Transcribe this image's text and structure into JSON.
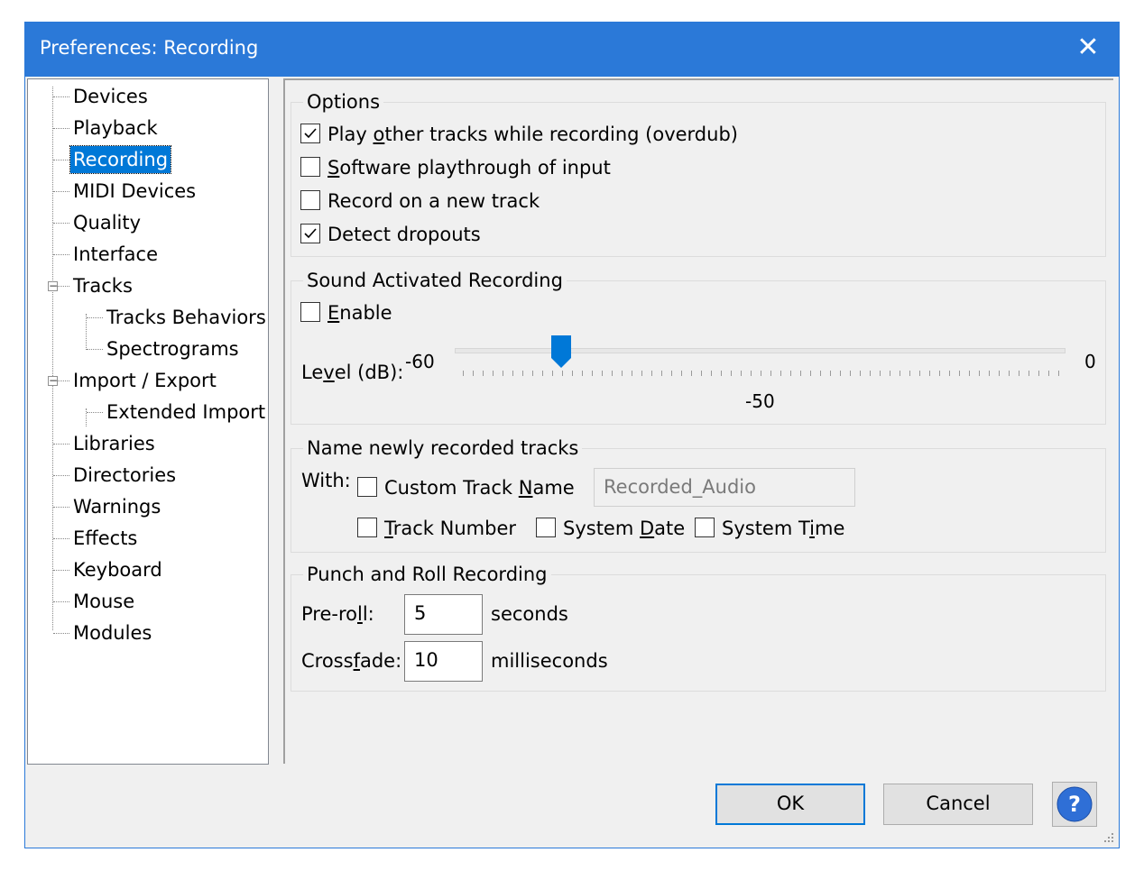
{
  "window": {
    "title": "Preferences: Recording",
    "close_glyph": "✕"
  },
  "tree": {
    "items": [
      {
        "label": "Devices"
      },
      {
        "label": "Playback"
      },
      {
        "label": "Recording",
        "selected": true
      },
      {
        "label": "MIDI Devices"
      },
      {
        "label": "Quality"
      },
      {
        "label": "Interface"
      },
      {
        "label": "Tracks",
        "expanded": true
      },
      {
        "label": "Tracks Behaviors"
      },
      {
        "label": "Spectrograms"
      },
      {
        "label": "Import / Export",
        "expanded": true
      },
      {
        "label": "Extended Import"
      },
      {
        "label": "Libraries"
      },
      {
        "label": "Directories"
      },
      {
        "label": "Warnings"
      },
      {
        "label": "Effects"
      },
      {
        "label": "Keyboard"
      },
      {
        "label": "Mouse"
      },
      {
        "label": "Modules"
      }
    ],
    "expander_glyph": "−"
  },
  "options": {
    "title": "Options",
    "overdub": {
      "pre": "Play ",
      "ul": "o",
      "post": "ther tracks while recording (overdub)",
      "checked": true
    },
    "playthrough": {
      "pre": "",
      "ul": "S",
      "post": "oftware playthrough of input",
      "checked": false
    },
    "new_track": {
      "label": "Record on a new track",
      "checked": false
    },
    "dropouts": {
      "label": "Detect dropouts",
      "checked": true
    }
  },
  "sound_activated": {
    "title": "Sound Activated Recording",
    "enable": {
      "pre": "",
      "ul": "E",
      "post": "nable",
      "checked": false
    },
    "level_label": {
      "pre": "Le",
      "ul": "v",
      "post": "el (dB):"
    },
    "min_label": "-60",
    "max_label": "0",
    "value_label": "-50",
    "min": -60,
    "max": 0,
    "value": -50
  },
  "naming": {
    "title": "Name newly recorded tracks",
    "with_label": "With:",
    "custom_name": {
      "pre": "Custom Track ",
      "ul": "N",
      "post": "ame",
      "checked": false
    },
    "custom_name_value": "Recorded_Audio",
    "track_number": {
      "pre": "",
      "ul": "T",
      "post": "rack Number",
      "checked": false
    },
    "system_date": {
      "pre": "System ",
      "ul": "D",
      "post": "ate",
      "checked": false
    },
    "system_time": {
      "pre": "System T",
      "ul": "i",
      "post": "me",
      "checked": false
    }
  },
  "punch_roll": {
    "title": "Punch and Roll Recording",
    "preroll_label": {
      "pre": "Pre-ro",
      "ul": "l",
      "post": "l:"
    },
    "preroll_value": "5",
    "preroll_unit": "seconds",
    "crossfade_label": {
      "pre": "Cross",
      "ul": "f",
      "post": "ade:"
    },
    "crossfade_value": "10",
    "crossfade_unit": "milliseconds"
  },
  "buttons": {
    "ok": "OK",
    "cancel": "Cancel",
    "help_glyph": "?"
  },
  "colors": {
    "accent": "#2b79d8",
    "selection": "#0078d7",
    "slider_thumb": "#0078d7",
    "help_icon": "#2f6fd6"
  }
}
